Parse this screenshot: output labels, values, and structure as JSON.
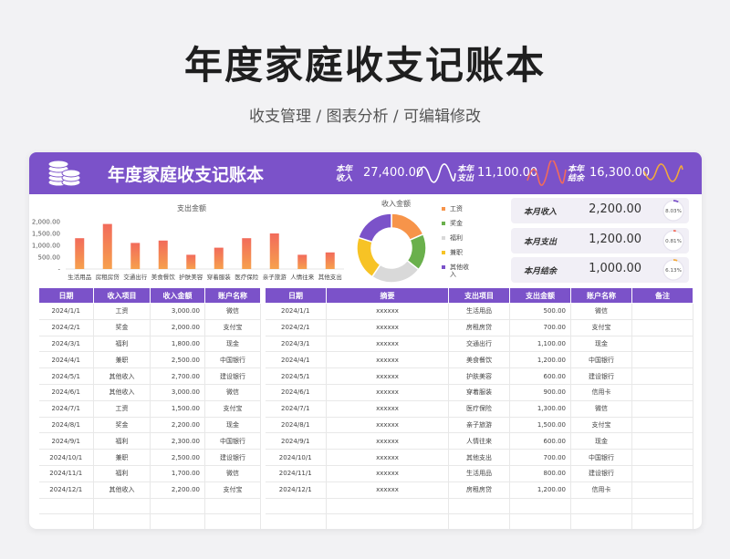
{
  "page": {
    "title": "年度家庭收支记账本",
    "subtitle": "收支管理 / 图表分析 / 可编辑修改"
  },
  "banner": {
    "title": "年度家庭收支记账本",
    "stats": [
      {
        "label": "本年收入",
        "value": "27,400.00",
        "wave_color": "#ffffff"
      },
      {
        "label": "本年支出",
        "value": "11,100.00",
        "wave_color": "#f26b5b"
      },
      {
        "label": "本年结余",
        "value": "16,300.00",
        "wave_color": "#f2a93b"
      }
    ]
  },
  "icons": {
    "banner": "coin-stack-icon"
  },
  "kpis": [
    {
      "label": "本月收入",
      "value": "2,200.00",
      "percent": "8.03%",
      "fraction": 0.0803,
      "color": "#7b52c9"
    },
    {
      "label": "本月支出",
      "value": "1,200.00",
      "percent": "0.81%",
      "fraction": 0.0081,
      "color": "#f26b5b"
    },
    {
      "label": "本月结余",
      "value": "1,000.00",
      "percent": "6.13%",
      "fraction": 0.0613,
      "color": "#f2a93b"
    }
  ],
  "chart_data": [
    {
      "type": "bar",
      "title": "支出金额",
      "categories": [
        "生活用品",
        "房租房贷",
        "交通出行",
        "美食餐饮",
        "护肤美容",
        "穿着服装",
        "医疗保险",
        "亲子旅游",
        "人情往来",
        "其他支出"
      ],
      "values": [
        1300,
        1900,
        1100,
        1200,
        600,
        900,
        1300,
        1500,
        600,
        700
      ],
      "yticks": [
        "2,000.00",
        "1,500.00",
        "1,000.00",
        "500.00",
        "-"
      ],
      "ylim": [
        0,
        2000
      ],
      "colors": [
        "#f26b5b",
        "#f6a04d"
      ]
    },
    {
      "type": "pie",
      "title": "收入金额",
      "categories": [
        "工资",
        "奖金",
        "福利",
        "兼职",
        "其他收入"
      ],
      "values": [
        4500,
        4200,
        5800,
        5000,
        4900
      ],
      "colors": [
        "#f7944a",
        "#6ab04c",
        "#d9d9d9",
        "#f7c325",
        "#7b52c9"
      ]
    }
  ],
  "income_table": {
    "headers": [
      "日期",
      "收入项目",
      "收入金额",
      "账户名称"
    ],
    "rows": [
      [
        "2024/1/1",
        "工资",
        "3,000.00",
        "微信"
      ],
      [
        "2024/2/1",
        "奖金",
        "2,000.00",
        "支付宝"
      ],
      [
        "2024/3/1",
        "福利",
        "1,800.00",
        "现金"
      ],
      [
        "2024/4/1",
        "兼职",
        "2,500.00",
        "中国银行"
      ],
      [
        "2024/5/1",
        "其他收入",
        "2,700.00",
        "建设银行"
      ],
      [
        "2024/6/1",
        "其他收入",
        "3,000.00",
        "微信"
      ],
      [
        "2024/7/1",
        "工资",
        "1,500.00",
        "支付宝"
      ],
      [
        "2024/8/1",
        "奖金",
        "2,200.00",
        "现金"
      ],
      [
        "2024/9/1",
        "福利",
        "2,300.00",
        "中国银行"
      ],
      [
        "2024/10/1",
        "兼职",
        "2,500.00",
        "建设银行"
      ],
      [
        "2024/11/1",
        "福利",
        "1,700.00",
        "微信"
      ],
      [
        "2024/12/1",
        "其他收入",
        "2,200.00",
        "支付宝"
      ],
      [
        "",
        "",
        "",
        ""
      ],
      [
        "",
        "",
        "",
        ""
      ]
    ]
  },
  "expense_table": {
    "headers": [
      "日期",
      "摘要",
      "支出项目",
      "支出金额",
      "账户名称",
      "备注"
    ],
    "rows": [
      [
        "2024/1/1",
        "xxxxxx",
        "生活用品",
        "500.00",
        "微信",
        ""
      ],
      [
        "2024/2/1",
        "xxxxxx",
        "房租房贷",
        "700.00",
        "支付宝",
        ""
      ],
      [
        "2024/3/1",
        "xxxxxx",
        "交通出行",
        "1,100.00",
        "现金",
        ""
      ],
      [
        "2024/4/1",
        "xxxxxx",
        "美食餐饮",
        "1,200.00",
        "中国银行",
        ""
      ],
      [
        "2024/5/1",
        "xxxxxx",
        "护肤美容",
        "600.00",
        "建设银行",
        ""
      ],
      [
        "2024/6/1",
        "xxxxxx",
        "穿着服装",
        "900.00",
        "信用卡",
        ""
      ],
      [
        "2024/7/1",
        "xxxxxx",
        "医疗保险",
        "1,300.00",
        "微信",
        ""
      ],
      [
        "2024/8/1",
        "xxxxxx",
        "亲子旅游",
        "1,500.00",
        "支付宝",
        ""
      ],
      [
        "2024/9/1",
        "xxxxxx",
        "人情往来",
        "600.00",
        "现金",
        ""
      ],
      [
        "2024/10/1",
        "xxxxxx",
        "其他支出",
        "700.00",
        "中国银行",
        ""
      ],
      [
        "2024/11/1",
        "xxxxxx",
        "生活用品",
        "800.00",
        "建设银行",
        ""
      ],
      [
        "2024/12/1",
        "xxxxxx",
        "房租房贷",
        "1,200.00",
        "信用卡",
        ""
      ],
      [
        "",
        "",
        "",
        "",
        "",
        ""
      ],
      [
        "",
        "",
        "",
        "",
        "",
        ""
      ]
    ]
  }
}
